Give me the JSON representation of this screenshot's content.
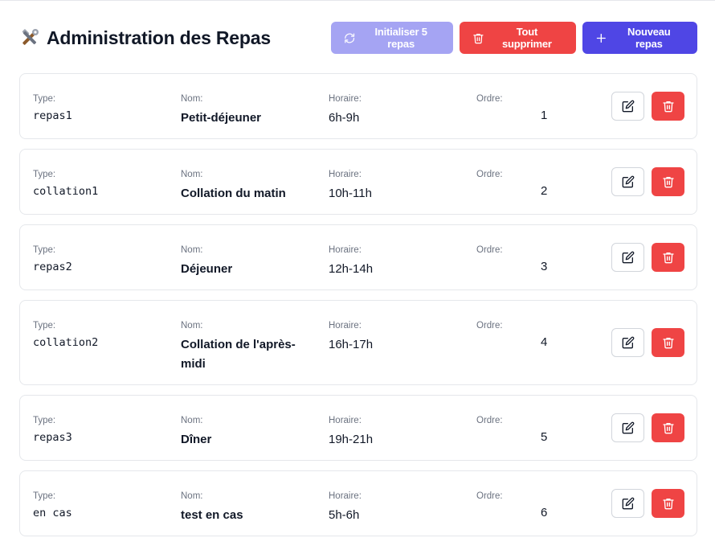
{
  "header": {
    "title": "Administration des Repas",
    "init_label": "Initialiser 5 repas",
    "delete_all_label": "Tout supprimer",
    "new_label": "Nouveau repas"
  },
  "labels": {
    "type": "Type:",
    "name": "Nom:",
    "hour": "Horaire:",
    "order": "Ordre:"
  },
  "colors": {
    "primary": "#4f46e5",
    "primary_disabled": "#a5a4f3",
    "danger": "#ef4444"
  },
  "meals": [
    {
      "type": "repas1",
      "name": "Petit-déjeuner",
      "hours": "6h-9h",
      "order": "1"
    },
    {
      "type": "collation1",
      "name": "Collation du matin",
      "hours": "10h-11h",
      "order": "2"
    },
    {
      "type": "repas2",
      "name": "Déjeuner",
      "hours": "12h-14h",
      "order": "3"
    },
    {
      "type": "collation2",
      "name": "Collation de l'après-midi",
      "hours": "16h-17h",
      "order": "4"
    },
    {
      "type": "repas3",
      "name": "Dîner",
      "hours": "19h-21h",
      "order": "5"
    },
    {
      "type": "en cas",
      "name": "test en cas",
      "hours": "5h-6h",
      "order": "6"
    }
  ]
}
